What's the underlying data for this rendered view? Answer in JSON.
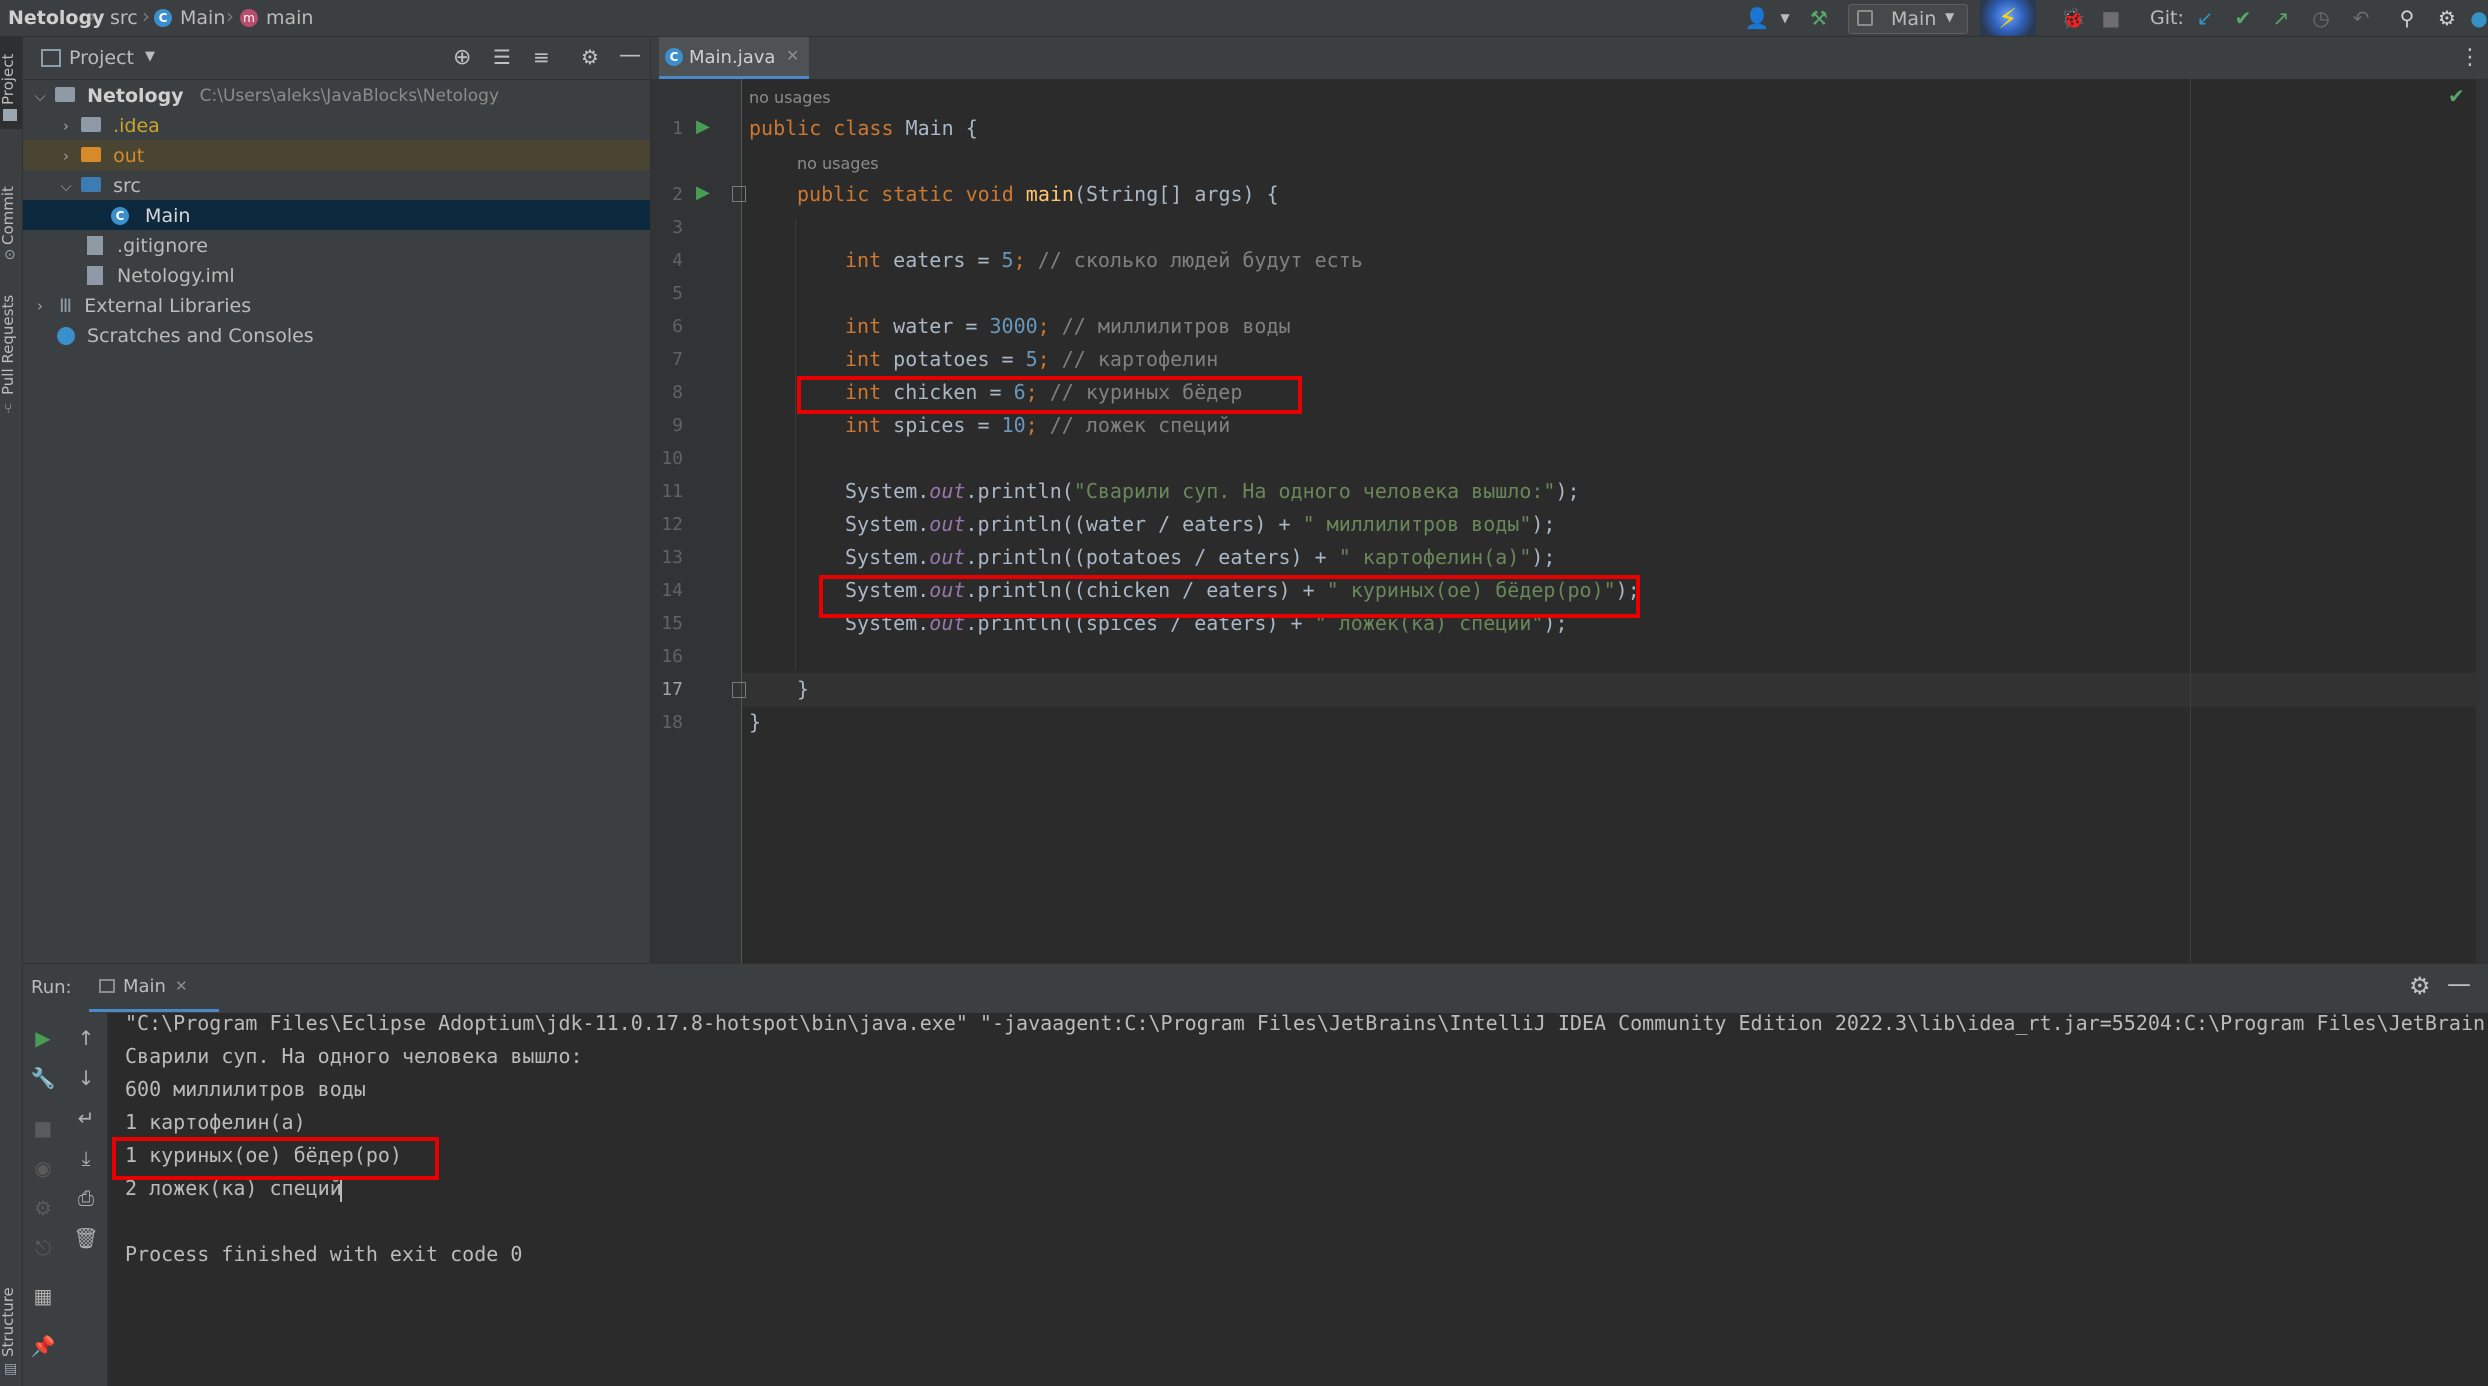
{
  "breadcrumb": {
    "project": "Netology",
    "src": "src",
    "class": "Main",
    "method": "main"
  },
  "toolbar": {
    "run_config": "Main",
    "git_label": "Git:"
  },
  "left_strip": {
    "project": "Project",
    "commit": "Commit",
    "pull_requests": "Pull Requests",
    "structure": "Structure"
  },
  "project_panel": {
    "title": "Project",
    "root_name": "Netology",
    "root_path": "C:\\Users\\aleks\\JavaBlocks\\Netology",
    "items": [
      {
        "label": ".idea"
      },
      {
        "label": "out"
      },
      {
        "label": "src"
      },
      {
        "label": "Main"
      },
      {
        "label": ".gitignore"
      },
      {
        "label": "Netology.iml"
      },
      {
        "label": "External Libraries"
      },
      {
        "label": "Scratches and Consoles"
      }
    ]
  },
  "editor": {
    "tab_label": "Main.java",
    "usage_hint": "no usages",
    "line_numbers": [
      "1",
      "2",
      "3",
      "4",
      "5",
      "6",
      "7",
      "8",
      "9",
      "10",
      "11",
      "12",
      "13",
      "14",
      "15",
      "16",
      "17",
      "18"
    ],
    "lines": {
      "l1_kw": "public class ",
      "l1_rest": "Main {",
      "l2_kw": "public static void ",
      "l2_mth": "main",
      "l2_rest": "(String[] args) {",
      "l4_kw": "int ",
      "l4_var": "eaters = ",
      "l4_num": "5",
      "l4_semi": "; ",
      "l4_cmt": "// сколько людей будут есть",
      "l6_kw": "int ",
      "l6_var": "water = ",
      "l6_num": "3000",
      "l6_semi": "; ",
      "l6_cmt": "// миллилитров воды",
      "l7_kw": "int ",
      "l7_var": "potatoes = ",
      "l7_num": "5",
      "l7_semi": "; ",
      "l7_cmt": "// картофелин",
      "l8_kw": "int ",
      "l8_var": "chicken = ",
      "l8_num": "6",
      "l8_semi": "; ",
      "l8_cmt": "// куриных бёдер",
      "l9_kw": "int ",
      "l9_var": "spices = ",
      "l9_num": "10",
      "l9_semi": "; ",
      "l9_cmt": "// ложек специй",
      "sys": "System.",
      "out": "out",
      "println_open": ".println(",
      "l11_str": "\"Сварили суп. На одного человека вышло:\"",
      "l11_end": ");",
      "l12_expr": "(water / eaters) + ",
      "l12_str": "\" миллилитров воды\"",
      "l12_end": ");",
      "l13_expr": "(potatoes / eaters) + ",
      "l13_str": "\" картофелин(а)\"",
      "l13_end": ");",
      "l14_expr": "(chicken / eaters) + ",
      "l14_str": "\" куриных(ое) бёдер(ро)\"",
      "l14_end": ");",
      "l15_expr": "(spices / eaters) + ",
      "l15_str": "\" ложек(ка) специй\"",
      "l15_end": ");",
      "l17": "}",
      "l18": "}"
    }
  },
  "run_panel": {
    "label": "Run:",
    "tab_label": "Main",
    "console_lines": [
      "\"C:\\Program Files\\Eclipse Adoptium\\jdk-11.0.17.8-hotspot\\bin\\java.exe\" \"-javaagent:C:\\Program Files\\JetBrains\\IntelliJ IDEA Community Edition 2022.3\\lib\\idea_rt.jar=55204:C:\\Program Files\\JetBrain",
      "Сварили суп. На одного человека вышло:",
      "600 миллилитров воды",
      "1 картофелин(а)",
      "1 куриных(ое) бёдер(ро)",
      "2 ложек(ка) специй",
      "",
      "Process finished with exit code 0"
    ]
  },
  "colors": {
    "highlight_box": "#e80000",
    "keyword": "#cc7832",
    "string": "#6a8759",
    "number": "#6897bb",
    "comment": "#808080"
  }
}
